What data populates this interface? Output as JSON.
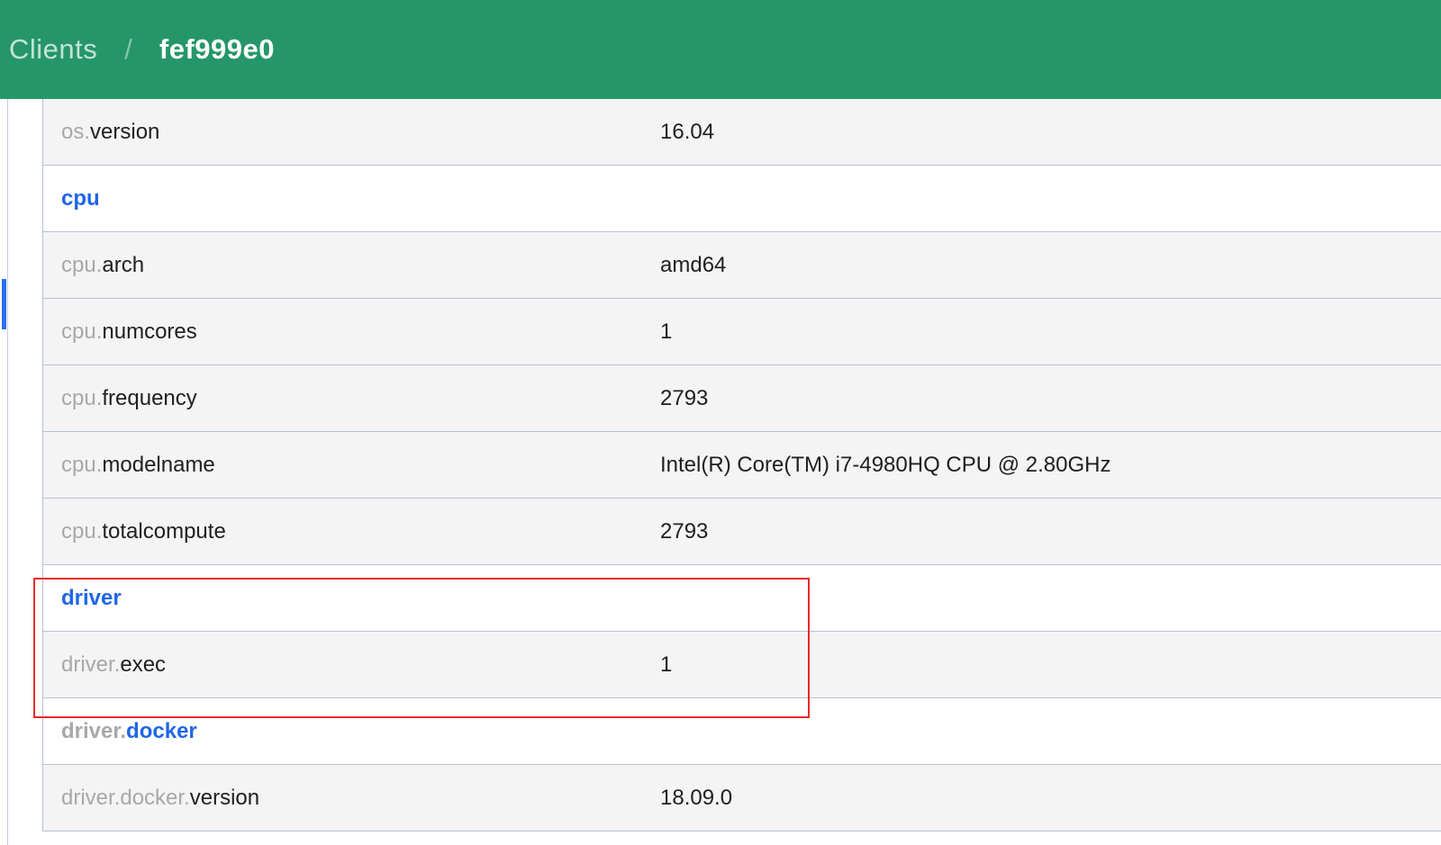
{
  "breadcrumb": {
    "parent": "Clients",
    "separator": "/",
    "current": "fef999e0"
  },
  "rows": [
    {
      "type": "attr",
      "prefix": "os.",
      "name": "version",
      "value": "16.04"
    },
    {
      "type": "group",
      "prefix": "",
      "name": "cpu"
    },
    {
      "type": "attr",
      "prefix": "cpu.",
      "name": "arch",
      "value": "amd64"
    },
    {
      "type": "attr",
      "prefix": "cpu.",
      "name": "numcores",
      "value": "1"
    },
    {
      "type": "attr",
      "prefix": "cpu.",
      "name": "frequency",
      "value": "2793"
    },
    {
      "type": "attr",
      "prefix": "cpu.",
      "name": "modelname",
      "value": "Intel(R) Core(TM) i7-4980HQ CPU @ 2.80GHz"
    },
    {
      "type": "attr",
      "prefix": "cpu.",
      "name": "totalcompute",
      "value": "2793"
    },
    {
      "type": "group",
      "prefix": "",
      "name": "driver"
    },
    {
      "type": "attr",
      "prefix": "driver.",
      "name": "exec",
      "value": "1"
    },
    {
      "type": "group",
      "prefix": "driver.",
      "name": "docker"
    },
    {
      "type": "attr",
      "prefix": "driver.docker.",
      "name": "version",
      "value": "18.09.0"
    }
  ],
  "colors": {
    "header": "#25966a",
    "link": "#1f66e6",
    "highlight": "#e8292b"
  }
}
